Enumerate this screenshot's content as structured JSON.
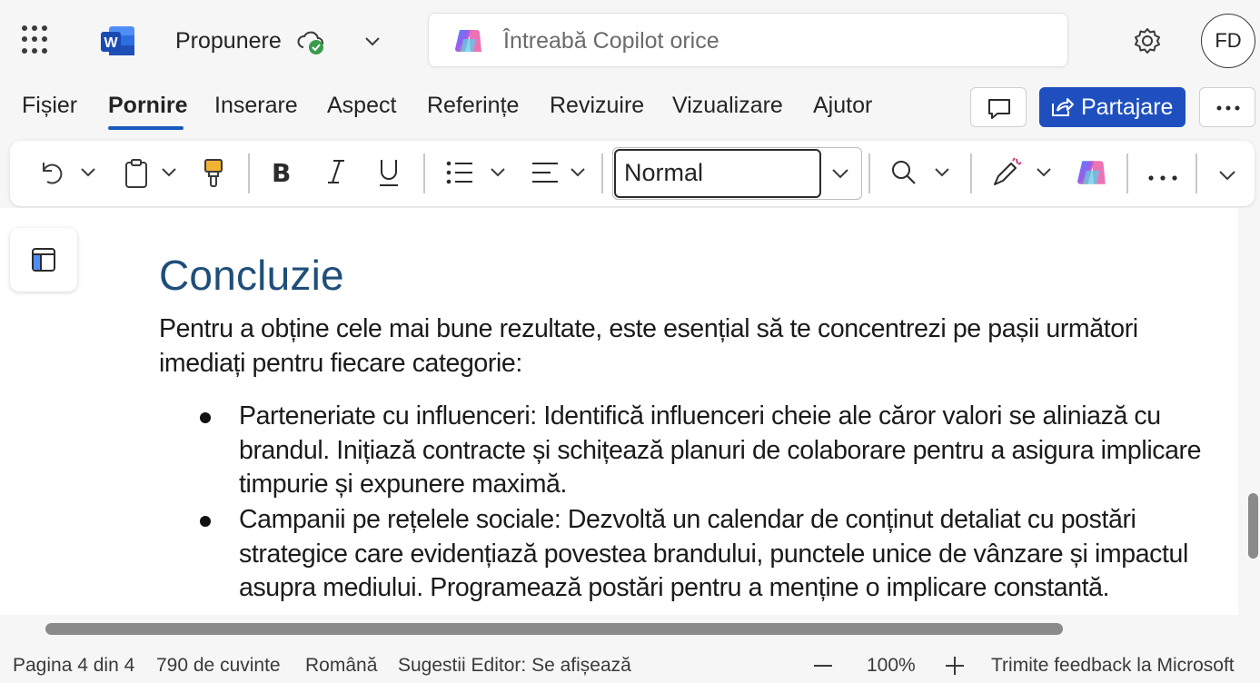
{
  "app": {
    "document_title": "Propunere",
    "search_placeholder": "Întreabă Copilot orice",
    "user_initials": "FD"
  },
  "tabs": [
    {
      "label": "Fișier",
      "active": false
    },
    {
      "label": "Pornire",
      "active": true
    },
    {
      "label": "Inserare",
      "active": false
    },
    {
      "label": "Aspect",
      "active": false
    },
    {
      "label": "Referințe",
      "active": false
    },
    {
      "label": "Revizuire",
      "active": false
    },
    {
      "label": "Vizualizare",
      "active": false
    },
    {
      "label": "Ajutor",
      "active": false
    }
  ],
  "actions": {
    "share_label": "Partajare"
  },
  "toolbar": {
    "style_value": "Normal",
    "icons": [
      "undo-icon",
      "clipboard-icon",
      "format-painter-icon",
      "bold-icon",
      "italic-icon",
      "underline-icon",
      "bullets-icon",
      "align-icon",
      "find-icon",
      "editor-icon",
      "copilot-icon",
      "more-icon"
    ]
  },
  "document": {
    "heading": "Concluzie",
    "intro": "Pentru a obține cele mai bune rezultate, este esențial să te concentrezi pe pașii următori imediați pentru fiecare categorie:",
    "bullets": [
      "Parteneriate cu influenceri: Identifică influenceri cheie ale căror valori se aliniază cu brandul. Inițiază contracte și schițează planuri de colaborare pentru a asigura implicare timpurie și expunere maximă.",
      "Campanii pe rețelele sociale: Dezvoltă un calendar de conținut detaliat cu postări strategice care evidențiază povestea brandului, punctele unice de vânzare și impactul asupra mediului. Programează postări pentru a menține o implicare constantă."
    ]
  },
  "status_bar": {
    "page": "Pagina 4 din 4",
    "words": "790 de cuvinte",
    "language": "Română",
    "editor": "Sugestii Editor: Se afișează",
    "zoom": "100%",
    "feedback": "Trimite feedback la Microsoft"
  },
  "colors": {
    "accent": "#185abd",
    "share_button": "#1f4fbf",
    "heading": "#1f4e79"
  }
}
